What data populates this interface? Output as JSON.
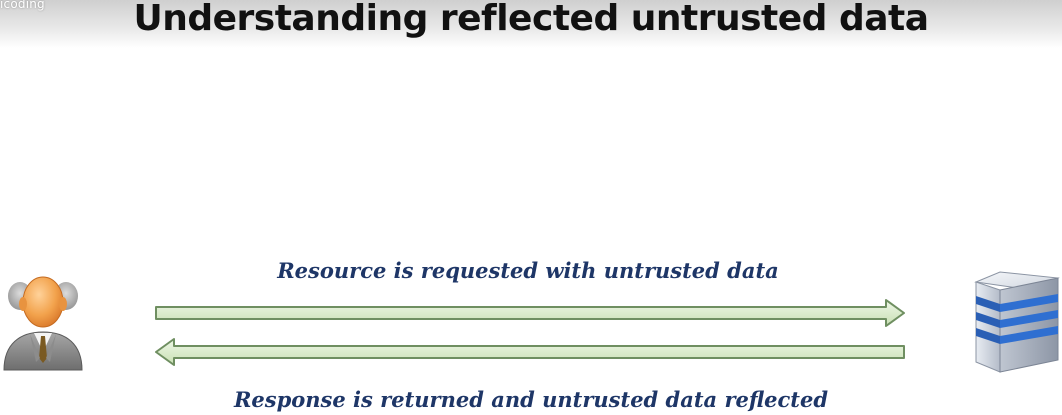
{
  "watermark": "icoding",
  "slide": {
    "title": "Understanding reflected untrusted data"
  },
  "diagram": {
    "request_label": "Resource is requested with untrusted data",
    "response_label": "Response is returned and untrusted data reflected",
    "client_icon": "user-icon",
    "server_icon": "server-icon",
    "colors": {
      "arrow_fill": "#d9ecc8",
      "arrow_stroke": "#6f8f61",
      "label_text": "#1e3667",
      "server_blue": "#2f6fd1"
    }
  }
}
